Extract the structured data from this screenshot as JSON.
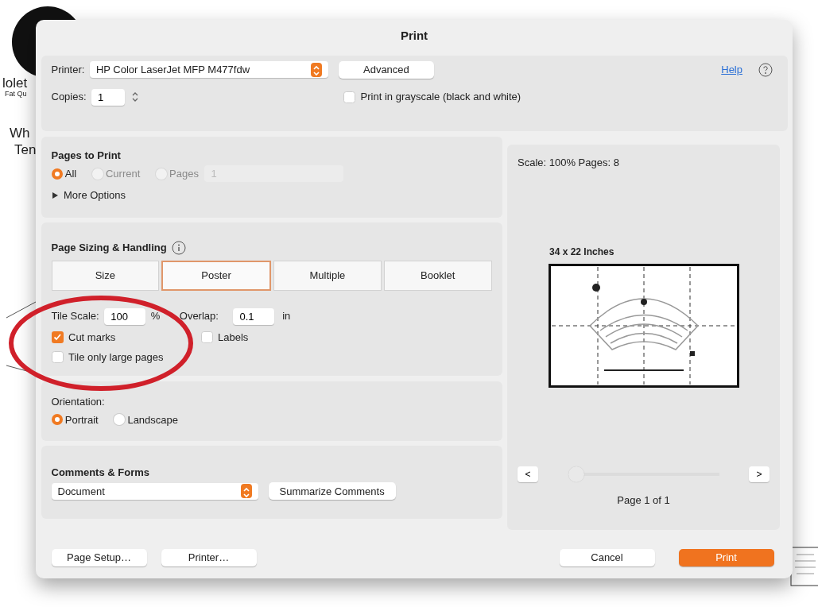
{
  "background": {
    "texts": [
      "lolet",
      "Fat Qu",
      "Wh",
      "Ten"
    ]
  },
  "window": {
    "title": "Print"
  },
  "printer": {
    "label": "Printer:",
    "value": "HP Color LaserJet MFP M477fdw",
    "advanced": "Advanced",
    "help": "Help"
  },
  "copies": {
    "label": "Copies:",
    "value": "1"
  },
  "grayscale": {
    "label": "Print in grayscale (black and white)",
    "checked": false
  },
  "pages_to_print": {
    "title": "Pages to Print",
    "options": [
      {
        "label": "All",
        "selected": true,
        "disabled": false
      },
      {
        "label": "Current",
        "selected": false,
        "disabled": true
      },
      {
        "label": "Pages",
        "selected": false,
        "disabled": true
      }
    ],
    "pages_value": "1",
    "more_options": {
      "label": "More Options",
      "expanded": false
    }
  },
  "page_sizing": {
    "title": "Page Sizing & Handling",
    "tabs": [
      {
        "label": "Size",
        "selected": false
      },
      {
        "label": "Poster",
        "selected": true
      },
      {
        "label": "Multiple",
        "selected": false
      },
      {
        "label": "Booklet",
        "selected": false
      }
    ],
    "tile_scale": {
      "label": "Tile Scale:",
      "value": "100",
      "unit": "%"
    },
    "overlap": {
      "label": "Overlap:",
      "value": "0.1",
      "unit": "in"
    },
    "checkboxes": [
      {
        "label": "Cut marks",
        "checked": true
      },
      {
        "label": "Labels",
        "checked": false
      },
      {
        "label": "Tile only large pages",
        "checked": false
      }
    ]
  },
  "orientation": {
    "title": "Orientation:",
    "options": [
      {
        "label": "Portrait",
        "selected": true
      },
      {
        "label": "Landscape",
        "selected": false
      }
    ]
  },
  "comments_forms": {
    "title": "Comments & Forms",
    "value": "Document",
    "summarize": "Summarize Comments"
  },
  "preview": {
    "summary": "Scale: 100% Pages: 8",
    "paper": "34 x 22 Inches",
    "prev": "<",
    "next": ">",
    "slider": {
      "level": 0
    },
    "page": "Page 1 of 1"
  },
  "footer": {
    "left": [
      {
        "label": "Page Setup…",
        "kind": "default"
      },
      {
        "label": "Printer…",
        "kind": "default"
      }
    ],
    "right": [
      {
        "label": "Cancel",
        "kind": "default"
      },
      {
        "label": "Print",
        "kind": "primary"
      }
    ]
  },
  "annotations": [
    {
      "kind": "ellipse",
      "color": "#d0202a"
    }
  ]
}
